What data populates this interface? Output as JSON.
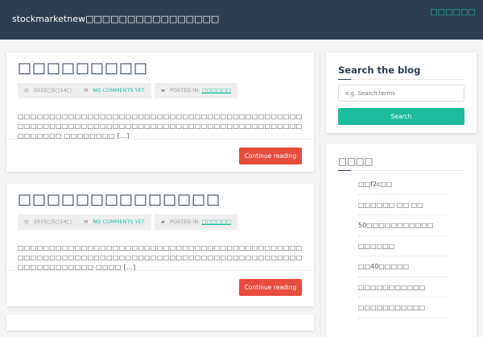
{
  "header": {
    "site_title": "stockmarketnew□□□□□□□□□□□□□□□□",
    "nav_link": "□□□□□□"
  },
  "posts": [
    {
      "title": "□□□□□□□□□",
      "date": "2015□5□14□",
      "comments": "NO COMMENTS YET",
      "posted_in_label": "POSTED IN:",
      "category": "□□□□□□",
      "excerpt": "□□□□□□□□□□□□□□□□□□□□□□□□□□□□□□□□□□□□□□□□□□□□□□□□□□□□□□□□□□□□□□□□□□□□□□□□□□□□□□□□□□□□□□□□□□□□□□□□□ □□□□□□□□ […]",
      "button": "Continue reading"
    },
    {
      "title": "□□□□□□□□□□□□□□",
      "date": "2015□5□14□",
      "comments": "NO COMMENTS YET",
      "posted_in_label": "POSTED IN:",
      "category": "□□□□□□",
      "excerpt": "□□□□□□□□□□□□□□□□□□□□□□□□□□□□□□□□□□□□□□□□□□□□□□□□□□□□□□□□□□□□□□□□□□□□□□□□□□□□□□□□□□□□□□□□□□□□□□□□□□□□□□ □□□□ […]",
      "button": "Continue reading"
    }
  ],
  "sidebar": {
    "search": {
      "title": "Search the blog",
      "placeholder": "e.g. Search terms",
      "button": "Search"
    },
    "recent": {
      "title": "□□□□",
      "items": [
        "□□f2c□□",
        "□□□□□□ □□ □□",
        "50□□□□□□□□□□□",
        "□□□□□□",
        "□□40□□□□□",
        "□□□□□□□□□□□",
        "□□□□□□□□□□□"
      ]
    }
  }
}
